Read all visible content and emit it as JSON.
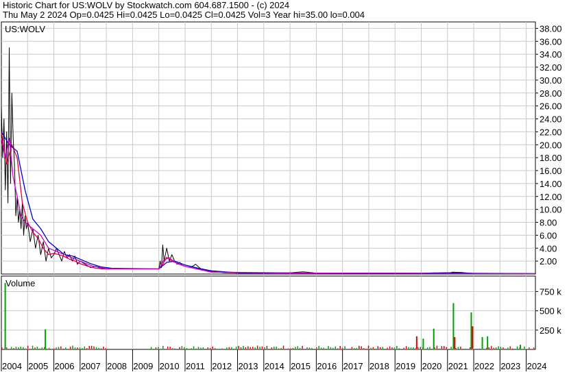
{
  "header": {
    "line1": "Historic Chart for US:WOLV by Stockwatch.com 604.687.1500 - (c) 2024",
    "line2": "Thu May  2 2024   Op=0.0425  Hi=0.0425  Lo=0.0425  Cl=0.0425  Vol=3  Year hi=35.00  lo=0.004"
  },
  "chart_data": [
    {
      "type": "line",
      "title": "US:WOLV",
      "ylim": [
        0,
        39
      ],
      "y_ticks": [
        "2.00",
        "4.00",
        "6.00",
        "8.00",
        "10.00",
        "12.00",
        "14.00",
        "16.00",
        "18.00",
        "20.00",
        "22.00",
        "24.00",
        "26.00",
        "28.00",
        "30.00",
        "32.00",
        "34.00",
        "36.00",
        "38.00"
      ],
      "x_ticks": [
        "2004",
        "2005",
        "2006",
        "2007",
        "2008",
        "2009",
        "2010",
        "2011",
        "2012",
        "2013",
        "2014",
        "2015",
        "2016",
        "2017",
        "2018",
        "2019",
        "2020",
        "2021",
        "2022",
        "2023",
        "2024"
      ],
      "xlim": [
        2004,
        2024.35
      ],
      "series": [
        {
          "color": "#000000",
          "x": [
            2004.0,
            2004.05,
            2004.1,
            2004.15,
            2004.2,
            2004.25,
            2004.3,
            2004.35,
            2004.4,
            2004.45,
            2004.5,
            2004.55,
            2004.6,
            2004.65,
            2004.7,
            2004.75,
            2004.8,
            2004.85,
            2004.9,
            2004.95,
            2005.0,
            2005.1,
            2005.2,
            2005.3,
            2005.4,
            2005.5,
            2005.6,
            2005.7,
            2005.8,
            2005.9,
            2006.0,
            2006.1,
            2006.2,
            2006.3,
            2006.4,
            2006.5,
            2006.6,
            2006.7,
            2006.8,
            2006.9,
            2007.0,
            2007.2,
            2007.4,
            2007.6,
            2007.8,
            2008.0,
            2008.5,
            2009.0,
            2009.5,
            2010.0,
            2010.05,
            2010.1,
            2010.15,
            2010.2,
            2010.25,
            2010.3,
            2010.4,
            2010.5,
            2010.6,
            2010.7,
            2010.8,
            2010.9,
            2011.0,
            2011.2,
            2011.4,
            2011.6,
            2011.8,
            2012.0,
            2012.5,
            2013.0,
            2014.0,
            2015.0,
            2015.5,
            2016.0,
            2017.0,
            2018.0,
            2019.0,
            2020.0,
            2020.5,
            2021.0,
            2021.2,
            2021.5,
            2022.0,
            2023.0,
            2024.0,
            2024.33
          ],
          "y": [
            26,
            18,
            24,
            13,
            22,
            11,
            35,
            14,
            28,
            21,
            17,
            9,
            12,
            8,
            10,
            7,
            11,
            6,
            9,
            7,
            8,
            5,
            7,
            4,
            6,
            3,
            5,
            2,
            4,
            2.5,
            3,
            4,
            3,
            2,
            3.5,
            2.5,
            3,
            2,
            2.8,
            1.5,
            2,
            1.5,
            1,
            1.2,
            0.8,
            0.8,
            0.8,
            0.8,
            0.8,
            0.8,
            2,
            1,
            4.5,
            2,
            3,
            4,
            2,
            3,
            2,
            1.5,
            1.8,
            1.3,
            1.2,
            1,
            1.5,
            0.8,
            0.6,
            0.4,
            0.2,
            0.15,
            0.15,
            0.2,
            0.35,
            0.15,
            0.12,
            0.12,
            0.12,
            0.1,
            0.12,
            0.12,
            0.3,
            0.25,
            0.1,
            0.08,
            0.05,
            0.04
          ]
        },
        {
          "color": "#e0003c",
          "x": [
            2004.0,
            2004.2,
            2004.4,
            2004.6,
            2004.8,
            2005.0,
            2005.2,
            2005.4,
            2005.6,
            2005.8,
            2006.0,
            2006.2,
            2006.4,
            2006.6,
            2006.8,
            2007.0,
            2007.3,
            2007.6,
            2008.0,
            2009.0,
            2010.0,
            2010.15,
            2010.3,
            2010.5,
            2010.8,
            2011.0,
            2011.5,
            2012.0,
            2013.0,
            2016.0,
            2020.0,
            2021.0,
            2022.0,
            2024.33
          ],
          "y": [
            22,
            17,
            20,
            18,
            11,
            8,
            6.5,
            5.5,
            4,
            3,
            3.2,
            3,
            2.7,
            2.3,
            2,
            1.6,
            1.2,
            0.9,
            0.8,
            0.8,
            0.8,
            1.5,
            2.6,
            2,
            1.5,
            1.2,
            0.8,
            0.4,
            0.15,
            0.15,
            0.12,
            0.2,
            0.1,
            0.05
          ]
        },
        {
          "color": "#0000cc",
          "x": [
            2004.0,
            2004.3,
            2004.6,
            2004.9,
            2005.2,
            2005.5,
            2005.8,
            2006.1,
            2006.4,
            2006.7,
            2007.0,
            2007.4,
            2007.8,
            2008.2,
            2009.0,
            2010.0,
            2010.3,
            2010.6,
            2011.0,
            2011.5,
            2012.0,
            2013.0,
            2016.0,
            2020.0,
            2021.0,
            2022.0,
            2024.33
          ],
          "y": [
            22,
            20,
            19,
            13,
            8.5,
            7,
            5,
            4,
            3,
            2.8,
            2.3,
            1.6,
            1.1,
            0.9,
            0.85,
            0.8,
            1.8,
            2,
            1.4,
            0.9,
            0.5,
            0.2,
            0.15,
            0.12,
            0.2,
            0.12,
            0.06
          ]
        },
        {
          "color": "#cc00cc",
          "x": [
            2004.0,
            2004.15,
            2004.3,
            2004.45,
            2004.6,
            2004.75,
            2004.9,
            2005.2,
            2005.5,
            2005.8,
            2006.1,
            2006.4,
            2006.7,
            2007.0,
            2007.5,
            2008.0,
            2009.0,
            2010.0,
            2010.2,
            2010.4,
            2010.7,
            2011.0,
            2012.0,
            2016.0,
            2024.33
          ],
          "y": [
            21,
            18,
            21,
            15,
            12,
            9,
            8,
            7,
            6,
            4,
            3.5,
            3,
            2.5,
            2,
            1.2,
            0.85,
            0.8,
            0.8,
            2.2,
            2.5,
            1.6,
            1.2,
            0.3,
            0.15,
            0.05
          ]
        }
      ]
    },
    {
      "type": "bar",
      "title": "Volume",
      "ylim": [
        0,
        950
      ],
      "y_ticks": [
        "250 k",
        "500 k",
        "750 k"
      ],
      "peaks": [
        {
          "x": 2004.12,
          "value": 860,
          "color": "#00a000"
        },
        {
          "x": 2005.65,
          "value": 260,
          "color": "#00a000"
        },
        {
          "x": 2020.45,
          "value": 270,
          "color": "#00a000"
        },
        {
          "x": 2021.2,
          "value": 600,
          "color": "#00a000"
        },
        {
          "x": 2021.25,
          "value": 160,
          "color": "#e00000"
        },
        {
          "x": 2021.88,
          "value": 480,
          "color": "#00a000"
        },
        {
          "x": 2021.93,
          "value": 300,
          "color": "#e00000"
        },
        {
          "x": 2019.8,
          "value": 170,
          "color": "#e00000"
        },
        {
          "x": 2020.05,
          "value": 140,
          "color": "#00a000"
        },
        {
          "x": 2022.3,
          "value": 160,
          "color": "#00a000"
        },
        {
          "x": 2022.5,
          "value": 170,
          "color": "#00a000"
        },
        {
          "x": 2023.75,
          "value": 60,
          "color": "#00a000"
        }
      ]
    }
  ]
}
